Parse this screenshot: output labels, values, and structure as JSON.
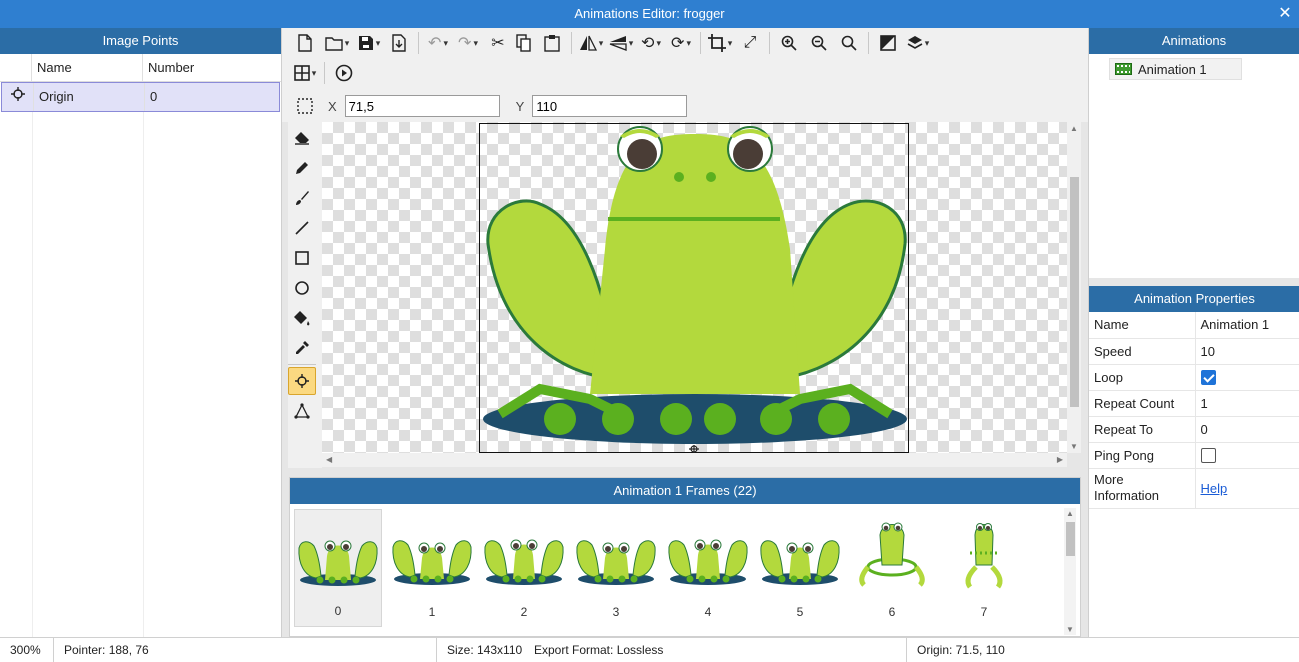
{
  "window": {
    "title": "Animations Editor: frogger",
    "close_icon": "✕"
  },
  "image_points": {
    "title": "Image Points",
    "columns": [
      "Name",
      "Number"
    ],
    "rows": [
      {
        "name": "Origin",
        "number": "0"
      }
    ]
  },
  "coords": {
    "x_label": "X",
    "x_value": "71,5",
    "y_label": "Y",
    "y_value": "110"
  },
  "frames_panel": {
    "title": "Animation 1 Frames (22)",
    "frames": [
      "0",
      "1",
      "2",
      "3",
      "4",
      "5",
      "6",
      "7"
    ]
  },
  "animations": {
    "title": "Animations",
    "items": [
      "Animation 1"
    ]
  },
  "properties": {
    "title": "Animation Properties",
    "name_label": "Name",
    "name_value": "Animation 1",
    "speed_label": "Speed",
    "speed_value": "10",
    "loop_label": "Loop",
    "loop_checked": true,
    "repeat_count_label": "Repeat Count",
    "repeat_count_value": "1",
    "repeat_to_label": "Repeat To",
    "repeat_to_value": "0",
    "ping_pong_label": "Ping Pong",
    "ping_pong_checked": false,
    "more_info_label_1": "More",
    "more_info_label_2": "Information",
    "help_link": "Help"
  },
  "status": {
    "zoom": "300%",
    "pointer": "Pointer: 188, 76",
    "size": "Size: 143x110",
    "export": "Export Format: Lossless",
    "origin": "Origin: 71.5, 110"
  },
  "colors": {
    "title_bar": "#2f7fd0",
    "panel_header": "#2b6da6",
    "frog_green": "#b3d93d",
    "pad_blue": "#1e4d6b"
  }
}
